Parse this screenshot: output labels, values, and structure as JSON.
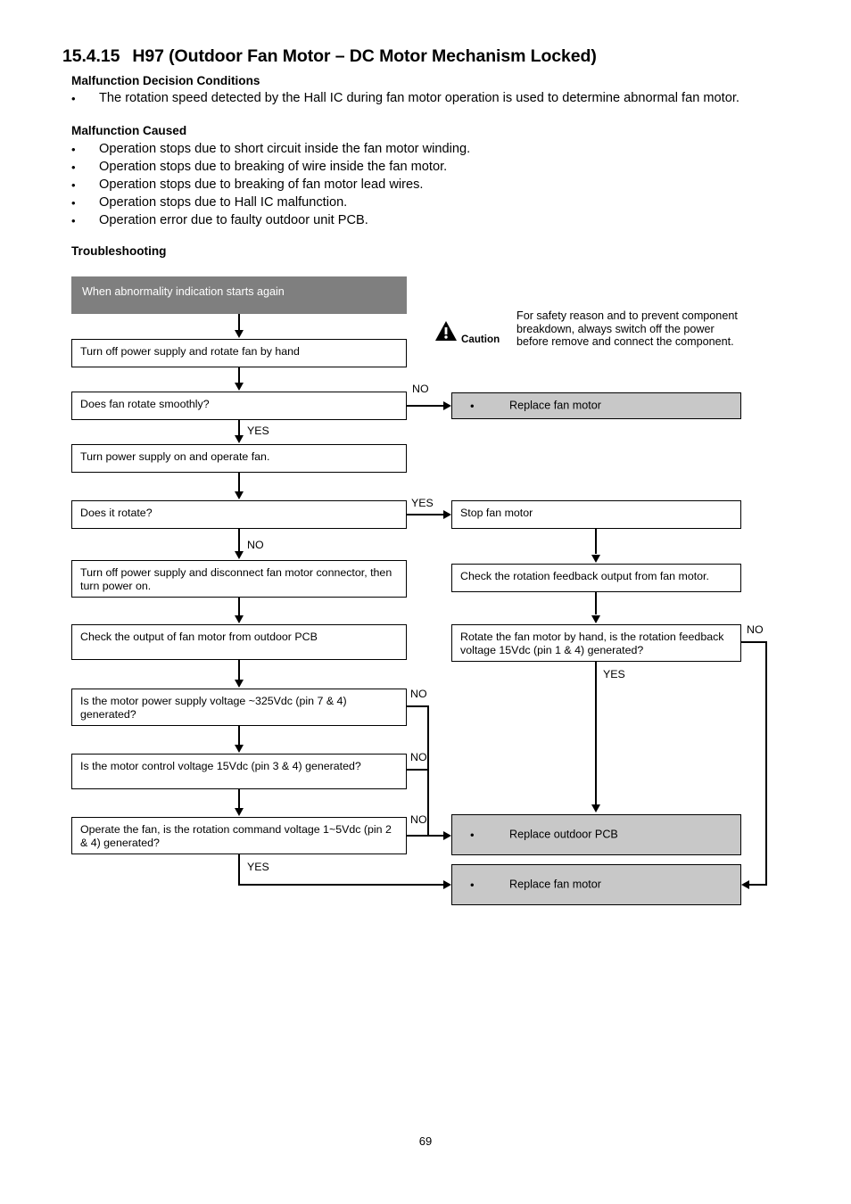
{
  "document": {
    "section_number": "15.4.15",
    "section_title": "H97 (Outdoor Fan Motor – DC Motor Mechanism Locked)",
    "page_number": "69",
    "headings": {
      "decision_conditions": "Malfunction Decision Conditions",
      "malfunction_caused": "Malfunction Caused",
      "troubleshooting": "Troubleshooting"
    },
    "decision_conditions": [
      "The rotation speed detected by the Hall IC during fan motor operation is used to determine abnormal fan motor."
    ],
    "malfunction_caused": [
      "Operation stops due to short circuit inside the fan motor winding.",
      "Operation stops due to breaking of wire inside the fan motor.",
      "Operation stops due to breaking of fan motor lead wires.",
      "Operation stops due to Hall IC malfunction.",
      "Operation error due to faulty outdoor unit PCB."
    ],
    "bullet_glyph": "•"
  },
  "caution": {
    "label": "Caution",
    "text": "For safety reason and to prevent component breakdown, always switch off the power before remove and connect the component.",
    "icon": "warning-triangle-icon"
  },
  "flowchart": {
    "colors": {
      "header_fill": "#7f7f7f",
      "header_text": "#ffffff",
      "result_fill": "#c8c8c8",
      "node_fill": "#ffffff",
      "line": "#000000"
    },
    "nodes": {
      "start": "When abnormality indication starts again",
      "turn_off_rotate": "Turn off power supply and rotate fan by hand",
      "fan_rotate_smoothly": "Does fan rotate smoothly?",
      "turn_on_operate": "Turn power supply on and operate fan.",
      "does_it_rotate": "Does it rotate?",
      "disconnect_connector": "Turn off power supply and disconnect fan motor connector, then turn power on.",
      "check_output_pcb": "Check the output of fan motor from outdoor PCB",
      "motor_power_supply": "Is the motor power supply voltage ~325Vdc (pin 7 & 4) generated?",
      "motor_control_voltage": "Is the motor control voltage 15Vdc (pin 3 & 4) generated?",
      "rotation_command": "Operate the fan, is the rotation command voltage 1~5Vdc (pin 2 & 4) generated?",
      "stop_fan_motor": "Stop fan motor",
      "check_feedback": "Check the rotation feedback output from fan motor.",
      "rotate_by_hand": "Rotate the fan motor by hand, is the rotation feedback voltage 15Vdc (pin 1 & 4) generated?",
      "replace_fan_motor_top": "Replace fan motor",
      "replace_outdoor_pcb": "Replace outdoor PCB",
      "replace_fan_motor_bottom": "Replace fan motor"
    },
    "edge_labels": {
      "no_smoothly": "NO",
      "yes_smoothly": "YES",
      "yes_rotate": "YES",
      "no_rotate": "NO",
      "no_power_supply": "NO",
      "no_control_voltage": "NO",
      "no_rotation_command": "NO",
      "yes_rotation_command": "YES",
      "no_feedback": "NO",
      "yes_feedback": "YES"
    }
  }
}
